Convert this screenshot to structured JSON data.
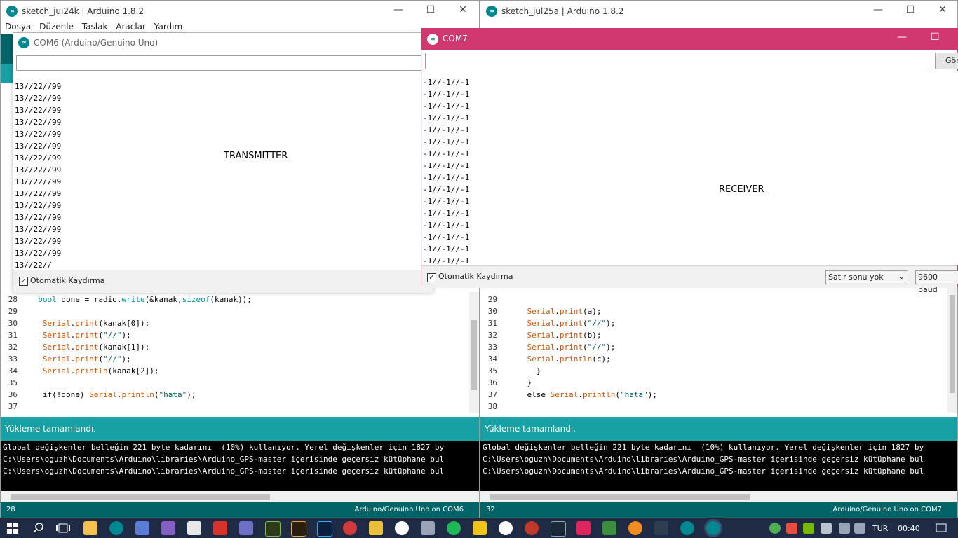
{
  "left_ide": {
    "title": "sketch_jul24k | Arduino 1.8.2",
    "menus": [
      "Dosya",
      "Düzenle",
      "Taslak",
      "Araclar",
      "Yardım"
    ],
    "code_lines": [
      {
        "n": "28",
        "segments": [
          {
            "t": "  "
          },
          {
            "t": "bool",
            "c": "kw2"
          },
          {
            "t": " done = radio."
          },
          {
            "t": "write",
            "c": "kw2"
          },
          {
            "t": "(&kanak,"
          },
          {
            "t": "sizeof",
            "c": "kw2"
          },
          {
            "t": "(kanak));"
          }
        ]
      },
      {
        "n": "29",
        "segments": [
          {
            "t": ""
          }
        ]
      },
      {
        "n": "30",
        "segments": [
          {
            "t": "   "
          },
          {
            "t": "Serial",
            "c": "kw"
          },
          {
            "t": "."
          },
          {
            "t": "print",
            "c": "kw"
          },
          {
            "t": "(kanak[0]);"
          }
        ]
      },
      {
        "n": "31",
        "segments": [
          {
            "t": "   "
          },
          {
            "t": "Serial",
            "c": "kw"
          },
          {
            "t": "."
          },
          {
            "t": "print",
            "c": "kw"
          },
          {
            "t": "("
          },
          {
            "t": "\"//\"",
            "c": "str"
          },
          {
            "t": ");"
          }
        ]
      },
      {
        "n": "32",
        "segments": [
          {
            "t": "   "
          },
          {
            "t": "Serial",
            "c": "kw"
          },
          {
            "t": "."
          },
          {
            "t": "print",
            "c": "kw"
          },
          {
            "t": "(kanak[1]);"
          }
        ]
      },
      {
        "n": "33",
        "segments": [
          {
            "t": "   "
          },
          {
            "t": "Serial",
            "c": "kw"
          },
          {
            "t": "."
          },
          {
            "t": "print",
            "c": "kw"
          },
          {
            "t": "("
          },
          {
            "t": "\"//\"",
            "c": "str"
          },
          {
            "t": ");"
          }
        ]
      },
      {
        "n": "34",
        "segments": [
          {
            "t": "   "
          },
          {
            "t": "Serial",
            "c": "kw"
          },
          {
            "t": "."
          },
          {
            "t": "println",
            "c": "kw"
          },
          {
            "t": "(kanak[2]);"
          }
        ]
      },
      {
        "n": "35",
        "segments": [
          {
            "t": ""
          }
        ]
      },
      {
        "n": "36",
        "segments": [
          {
            "t": "   if(!done) "
          },
          {
            "t": "Serial",
            "c": "kw"
          },
          {
            "t": "."
          },
          {
            "t": "println",
            "c": "kw"
          },
          {
            "t": "("
          },
          {
            "t": "\"hata\"",
            "c": "str"
          },
          {
            "t": ");"
          }
        ]
      },
      {
        "n": "37",
        "segments": [
          {
            "t": ""
          }
        ]
      }
    ],
    "status": "Yükleme tamamlandı.",
    "console_lines": [
      "Global değişkenler belleğin 221 byte kadarını  (10%) kullanıyor. Yerel değişkenler için 1827 by",
      "C:\\Users\\oguzh\\Documents\\Arduino\\libraries\\Arduino_GPS-master içerisinde geçersiz kütüphane bul",
      "C:\\Users\\oguzh\\Documents\\Arduino\\libraries\\Arduino_GPS-master içerisinde geçersiz kütüphane bul"
    ],
    "line_number": "28",
    "board": "Arduino/Genuino Uno on COM6"
  },
  "right_ide": {
    "title": "sketch_jul25a | Arduino 1.8.2",
    "code_lines": [
      {
        "n": "29",
        "segments": [
          {
            "t": ""
          }
        ]
      },
      {
        "n": "30",
        "segments": [
          {
            "t": "    "
          },
          {
            "t": "Serial",
            "c": "kw"
          },
          {
            "t": "."
          },
          {
            "t": "print",
            "c": "kw"
          },
          {
            "t": "(a);"
          }
        ]
      },
      {
        "n": "31",
        "segments": [
          {
            "t": "    "
          },
          {
            "t": "Serial",
            "c": "kw"
          },
          {
            "t": "."
          },
          {
            "t": "print",
            "c": "kw"
          },
          {
            "t": "("
          },
          {
            "t": "\"//\"",
            "c": "str"
          },
          {
            "t": ");"
          }
        ]
      },
      {
        "n": "32",
        "segments": [
          {
            "t": "    "
          },
          {
            "t": "Serial",
            "c": "kw"
          },
          {
            "t": "."
          },
          {
            "t": "print",
            "c": "kw"
          },
          {
            "t": "(b);"
          }
        ]
      },
      {
        "n": "33",
        "segments": [
          {
            "t": "    "
          },
          {
            "t": "Serial",
            "c": "kw"
          },
          {
            "t": "."
          },
          {
            "t": "print",
            "c": "kw"
          },
          {
            "t": "("
          },
          {
            "t": "\"//\"",
            "c": "str"
          },
          {
            "t": ");"
          }
        ]
      },
      {
        "n": "34",
        "segments": [
          {
            "t": "    "
          },
          {
            "t": "Serial",
            "c": "kw"
          },
          {
            "t": "."
          },
          {
            "t": "println",
            "c": "kw"
          },
          {
            "t": "(c);"
          }
        ]
      },
      {
        "n": "35",
        "segments": [
          {
            "t": "      }"
          }
        ]
      },
      {
        "n": "36",
        "segments": [
          {
            "t": "    }"
          }
        ]
      },
      {
        "n": "37",
        "segments": [
          {
            "t": "    else "
          },
          {
            "t": "Serial",
            "c": "kw"
          },
          {
            "t": "."
          },
          {
            "t": "println",
            "c": "kw"
          },
          {
            "t": "("
          },
          {
            "t": "\"hata\"",
            "c": "str"
          },
          {
            "t": ");"
          }
        ]
      },
      {
        "n": "38",
        "segments": [
          {
            "t": ""
          }
        ]
      }
    ],
    "status": "Yükleme tamamlandı.",
    "console_lines": [
      "Global değişkenler belleğin 221 byte kadarını  (10%) kullanıyor. Yerel değişkenler için 1827 by",
      "C:\\Users\\oguzh\\Documents\\Arduino\\libraries\\Arduino_GPS-master içerisinde geçersiz kütüphane bul",
      "C:\\Users\\oguzh\\Documents\\Arduino\\libraries\\Arduino_GPS-master içerisinde geçersiz kütüphane bul"
    ],
    "line_number": "32",
    "board": "Arduino/Genuino Uno on COM7"
  },
  "com6": {
    "title": "COM6 (Arduino/Genuino Uno)",
    "input_value": "",
    "lines": [
      "13//22//99",
      "13//22//99",
      "13//22//99",
      "13//22//99",
      "13//22//99",
      "13//22//99",
      "13//22//99",
      "13//22//99",
      "13//22//99",
      "13//22//99",
      "13//22//99",
      "13//22//99",
      "13//22//99",
      "13//22//99",
      "13//22//99",
      "13//22//"
    ],
    "overlay": "TRANSMITTER",
    "autoscroll_label": "Otomatik Kaydırma"
  },
  "com7": {
    "title": "COM7",
    "input_value": "",
    "send_label": "Gön",
    "lines": [
      "-1//-1//-1",
      "-1//-1//-1",
      "-1//-1//-1",
      "-1//-1//-1",
      "-1//-1//-1",
      "-1//-1//-1",
      "-1//-1//-1",
      "-1//-1//-1",
      "-1//-1//-1",
      "-1//-1//-1",
      "-1//-1//-1",
      "-1//-1//-1",
      "-1//-1//-1",
      "-1//-1//-1",
      "-1//-1//-1",
      "-1//-1//-1"
    ],
    "overlay": "RECEIVER",
    "autoscroll_label": "Otomatik Kaydırma",
    "line_ending": "Satır sonu yok",
    "baud": "9600 baud",
    "accent": "#d0386f"
  },
  "taskbar": {
    "language": "TUR",
    "time": "00:40"
  }
}
